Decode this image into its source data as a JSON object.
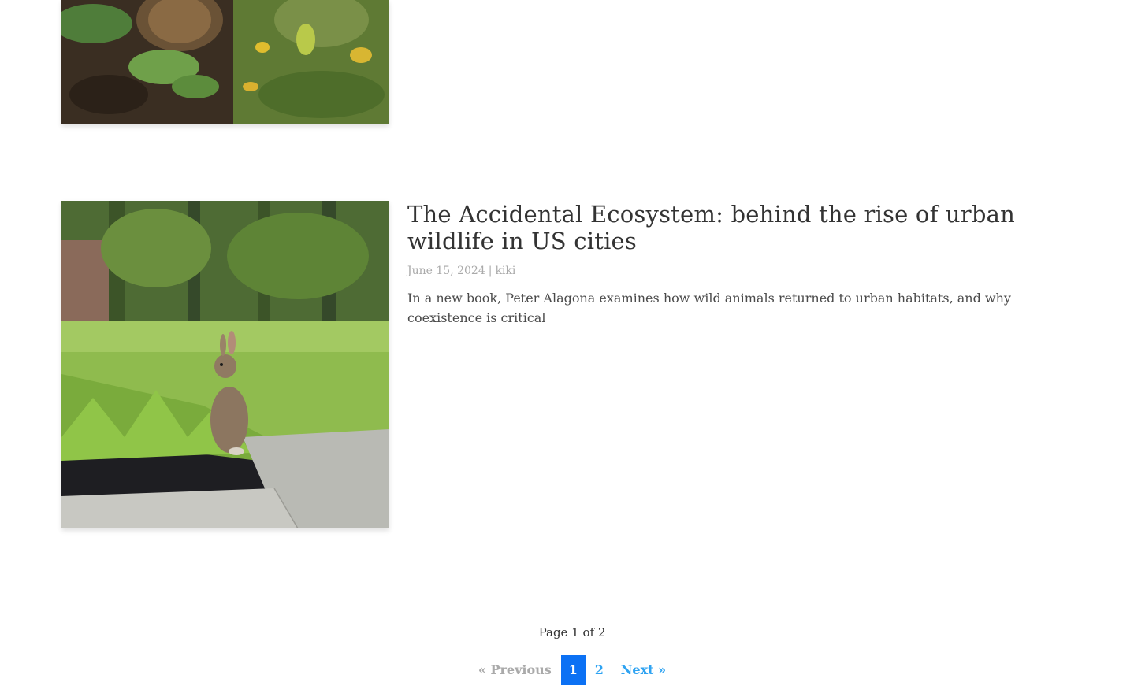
{
  "post": {
    "title": "The Accidental Ecosystem: behind the rise of urban wildlife in US cities",
    "date": "June 15, 2024",
    "meta_separator": "|",
    "author": "kiki",
    "excerpt": "In a new book, Peter Alagona examines how wild animals returned to urban habitats, and why coexistence is critical"
  },
  "pagination": {
    "info": "Page 1 of 2",
    "previous_label": "« Previous",
    "pages": [
      "1",
      "2"
    ],
    "current_page": "1",
    "next_label": "Next »"
  },
  "colors": {
    "title": "#333333",
    "meta": "#aaaaaa",
    "link": "#2ea3f2",
    "current_page_bg": "#0c71f4"
  }
}
